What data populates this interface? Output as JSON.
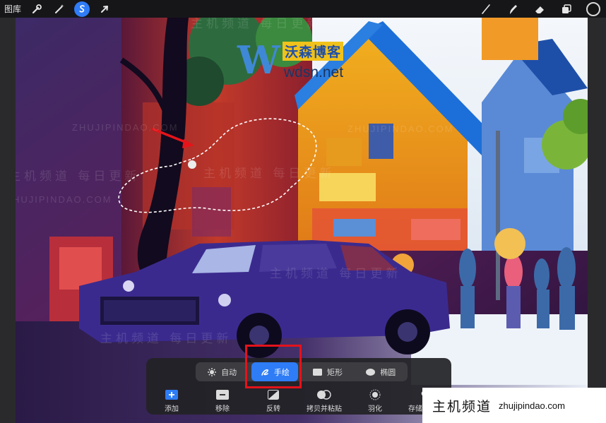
{
  "topbar": {
    "gallery_label": "图库",
    "tools_left": [
      {
        "name": "actions",
        "icon": "wrench-icon"
      },
      {
        "name": "adjustments",
        "icon": "magic-wand-icon"
      },
      {
        "name": "selection",
        "icon": "selection-s-icon",
        "active": true
      },
      {
        "name": "transform",
        "icon": "arrow-cursor-icon"
      }
    ],
    "tools_right": [
      {
        "name": "brush",
        "icon": "brush-icon"
      },
      {
        "name": "smudge",
        "icon": "smudge-icon"
      },
      {
        "name": "eraser",
        "icon": "eraser-icon"
      },
      {
        "name": "layers",
        "icon": "layers-icon"
      },
      {
        "name": "color",
        "icon": "color-swatch-icon",
        "color": "#151515"
      }
    ],
    "active_color": "#2f7cf6"
  },
  "watermark": {
    "logo_letter": "W",
    "logo_cn": "沃森博客",
    "logo_url": "wdsn.net",
    "ghost_cn": "主机频道 每日更新",
    "ghost_url": "ZHUJIPINDAO.COM"
  },
  "selection_toolbar": {
    "modes": [
      {
        "label": "自动",
        "icon": "gear-dot-icon",
        "active": false
      },
      {
        "label": "手绘",
        "icon": "freehand-icon",
        "active": true
      },
      {
        "label": "矩形",
        "icon": "rectangle-icon",
        "active": false
      },
      {
        "label": "椭圆",
        "icon": "ellipse-icon",
        "active": false
      }
    ],
    "actions": [
      {
        "label": "添加",
        "icon": "add-icon"
      },
      {
        "label": "移除",
        "icon": "remove-icon"
      },
      {
        "label": "反转",
        "icon": "invert-icon"
      },
      {
        "label": "拷贝并粘贴",
        "icon": "copy-paste-icon"
      },
      {
        "label": "羽化",
        "icon": "feather-icon"
      },
      {
        "label": "存储并加载",
        "icon": "heart-save-icon"
      }
    ],
    "active_color": "#2e7cf6",
    "highlight_color": "#e3131b"
  },
  "brand": {
    "name_cn": "主机频道",
    "domain": "zhujipindao.com"
  }
}
